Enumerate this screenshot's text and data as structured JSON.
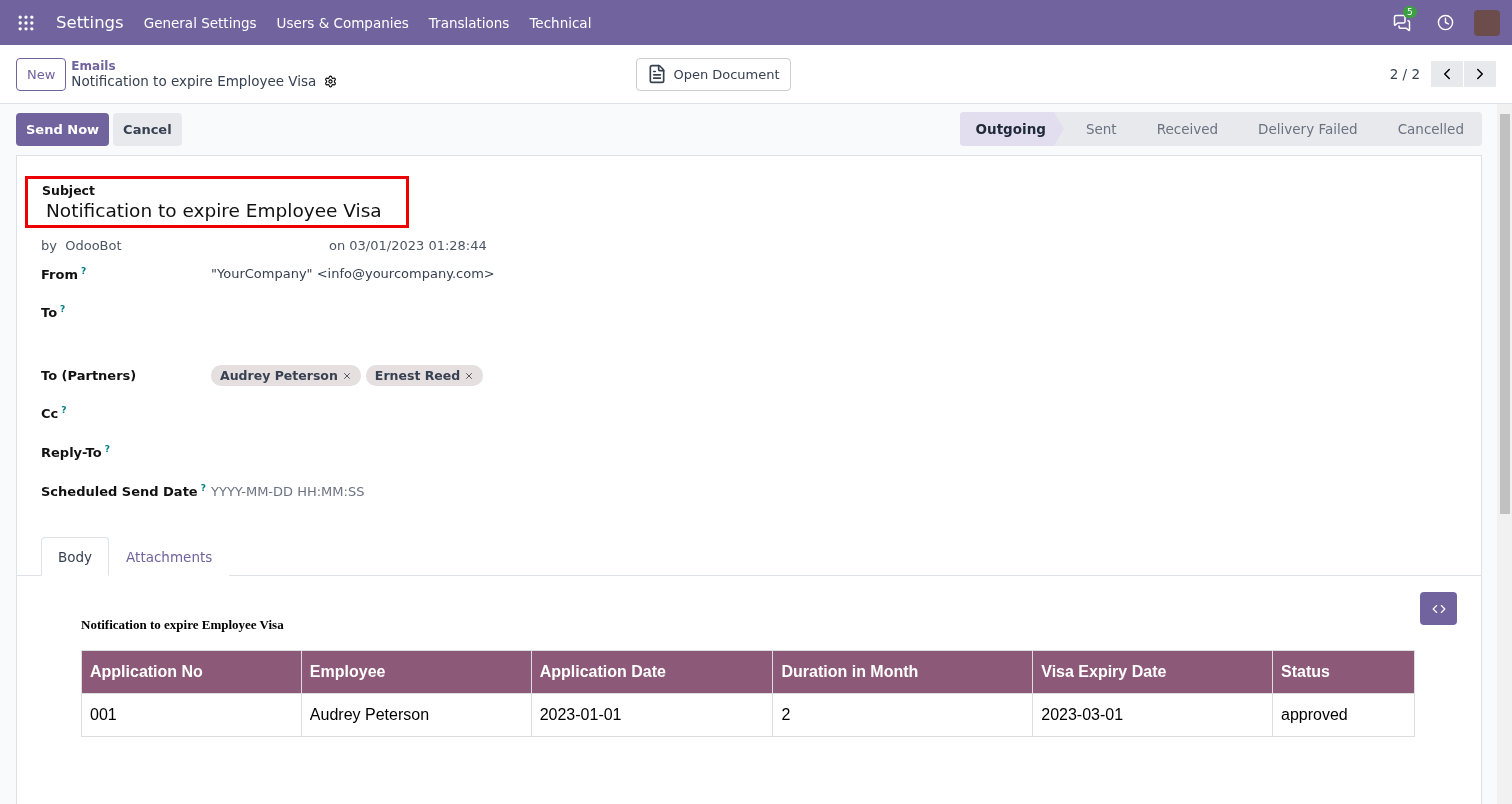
{
  "navbar": {
    "app_name": "Settings",
    "menu": [
      "General Settings",
      "Users & Companies",
      "Translations",
      "Technical"
    ],
    "messages_badge": "5"
  },
  "control_panel": {
    "new_button": "New",
    "breadcrumb": "Emails",
    "record_title": "Notification to expire Employee Visa",
    "open_document": "Open Document",
    "pager": "2 / 2"
  },
  "actions": [
    "Send Now",
    "Cancel"
  ],
  "status_steps": [
    {
      "label": "Outgoing",
      "selected": true
    },
    {
      "label": "Sent",
      "selected": false
    },
    {
      "label": "Received",
      "selected": false
    },
    {
      "label": "Delivery Failed",
      "selected": false
    },
    {
      "label": "Cancelled",
      "selected": false
    }
  ],
  "form": {
    "subject_label": "Subject",
    "subject": "Notification to expire Employee Visa",
    "author_prefix": "by",
    "author": "OdooBot",
    "date": "on 03/01/2023 01:28:44",
    "fields": [
      {
        "label": "From",
        "help": "?",
        "kind": "text",
        "value": "\"YourCompany\" <info@yourcompany.com>"
      },
      {
        "label": "To",
        "help": "?",
        "kind": "tall"
      },
      {
        "label": "To (Partners)",
        "kind": "tags",
        "tags": [
          "Audrey Peterson",
          "Ernest Reed"
        ]
      },
      {
        "label": "Cc",
        "help": "?",
        "kind": "text"
      },
      {
        "label": "Reply-To",
        "help": "?",
        "kind": "text"
      },
      {
        "label": "Scheduled Send Date",
        "help": "?",
        "kind": "input",
        "placeholder": "YYYY-MM-DD HH:MM:SS"
      }
    ]
  },
  "tabs": [
    {
      "label": "Body",
      "selected": true
    },
    {
      "label": "Attachments",
      "selected": false
    }
  ],
  "body": {
    "heading": "Notification to expire Employee Visa",
    "table": {
      "columns": [
        "Application No",
        "Employee",
        "Application Date",
        "Duration in Month",
        "Visa Expiry Date",
        "Status"
      ],
      "rows": [
        [
          "001",
          "Audrey Peterson",
          "2023-01-01",
          "2",
          "2023-03-01",
          "approved"
        ]
      ]
    }
  }
}
